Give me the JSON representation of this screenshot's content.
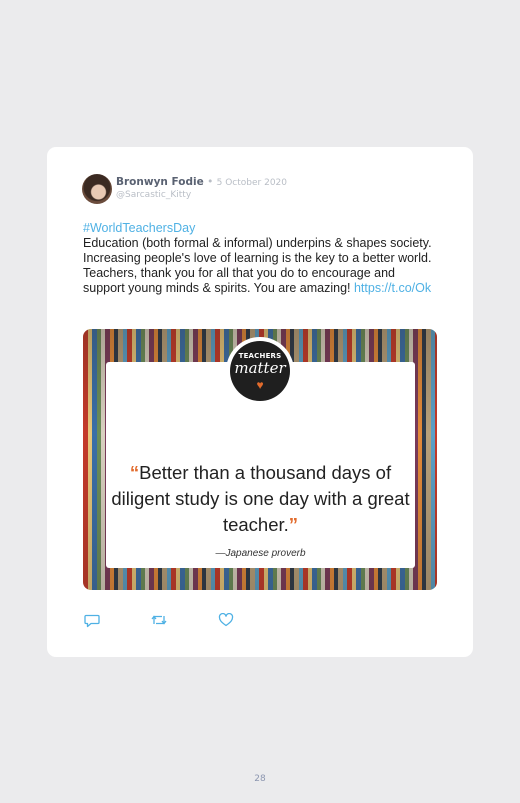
{
  "tweet": {
    "author_name": "Bronwyn Fodie",
    "separator": " • ",
    "date": "5 October 2020",
    "handle": "@Sarcastic_Kitty",
    "hashtag": "#WorldTeachersDay",
    "text": "Education (both formal & informal) underpins & shapes society. Increasing people's love of learning is the key to a better world. Teachers, thank you for all that you do to encourage and support young minds & spirits. You are amazing! ",
    "link": "https://t.co/Ok"
  },
  "media": {
    "badge_line1": "TEACHERS",
    "badge_line2": "matter",
    "quote_open": "“",
    "quote": "Better than a thousand days of diligent study is one day with a great teacher.",
    "quote_close": "”",
    "attribution": "—Japanese proverb"
  },
  "actions": {
    "reply_icon": "reply-icon",
    "retweet_icon": "retweet-icon",
    "like_icon": "heart-icon"
  },
  "footer": {
    "page_number": "28"
  },
  "colors": {
    "background": "#ebebed",
    "link": "#4fb1e4",
    "accent": "#e26b2c"
  }
}
